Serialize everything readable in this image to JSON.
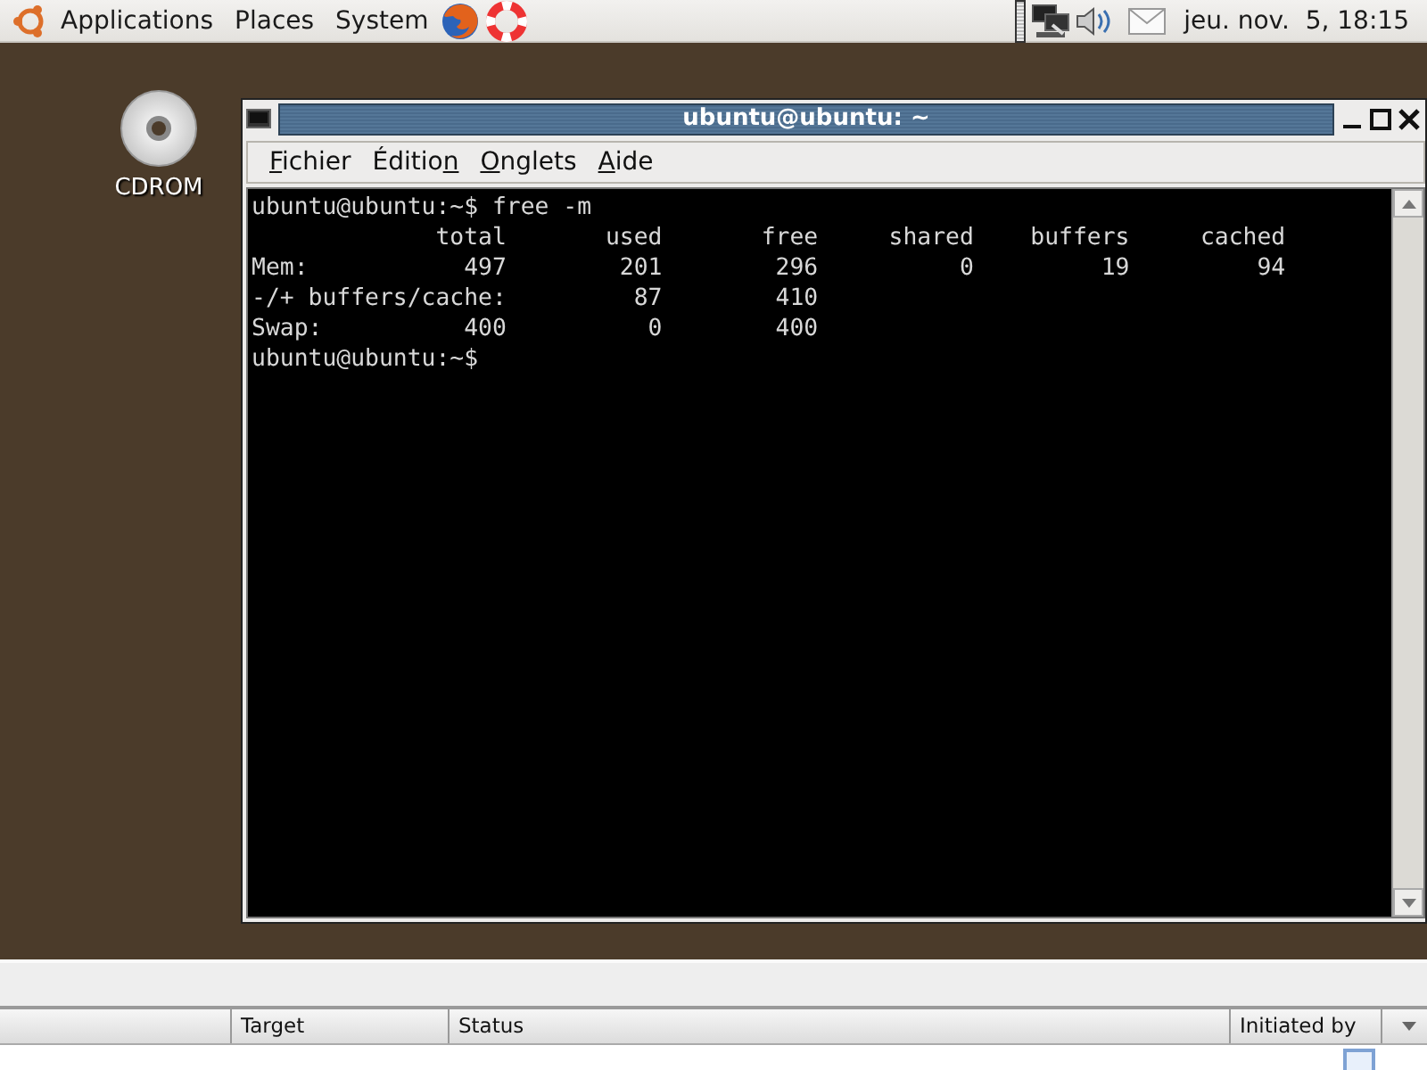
{
  "top_panel": {
    "menus": [
      "Applications",
      "Places",
      "System"
    ],
    "clock": "jeu. nov.  5, 18:15"
  },
  "desktop_icons": [
    {
      "label": "CDROM"
    }
  ],
  "terminal": {
    "title": "ubuntu@ubuntu: ~",
    "menus": [
      {
        "access_key": "F",
        "rest": "ichier"
      },
      {
        "before": "Éditio",
        "access_key": "n"
      },
      {
        "access_key": "O",
        "rest": "nglets"
      },
      {
        "access_key": "A",
        "rest": "ide"
      }
    ],
    "lines": [
      "ubuntu@ubuntu:~$ free -m",
      "             total       used       free     shared    buffers     cached",
      "Mem:           497        201        296          0         19         94",
      "-/+ buffers/cache:         87        410",
      "Swap:          400          0        400",
      "ubuntu@ubuntu:~$"
    ]
  },
  "transfer_list": {
    "columns": [
      "Target",
      "Status",
      "Initiated by"
    ]
  }
}
